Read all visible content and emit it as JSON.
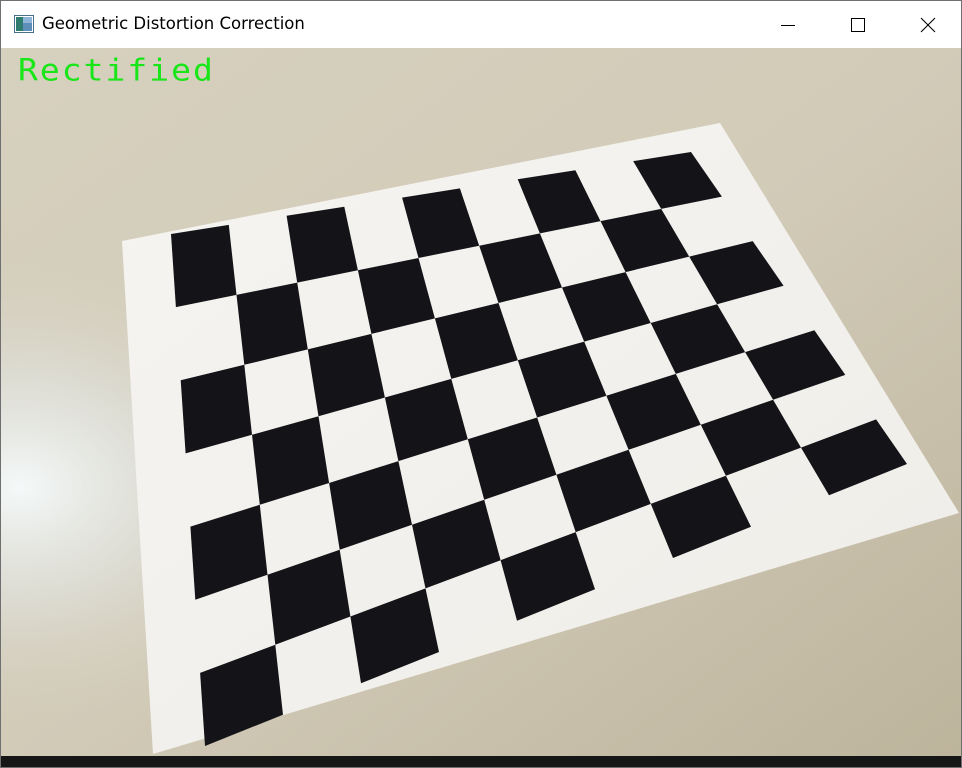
{
  "window": {
    "title": "Geometric Distortion Correction",
    "icon": "opencv-window-icon",
    "controls": {
      "minimize_icon": "minimize-icon",
      "maximize_icon": "maximize-icon",
      "close_icon": "close-icon"
    }
  },
  "image": {
    "overlay_label": "Rectified",
    "overlay_color": "#19e619",
    "subject": "checkerboard",
    "colors": {
      "table": "#d2cbb8",
      "paper": "#f3f2ef",
      "square": "#141418"
    }
  }
}
